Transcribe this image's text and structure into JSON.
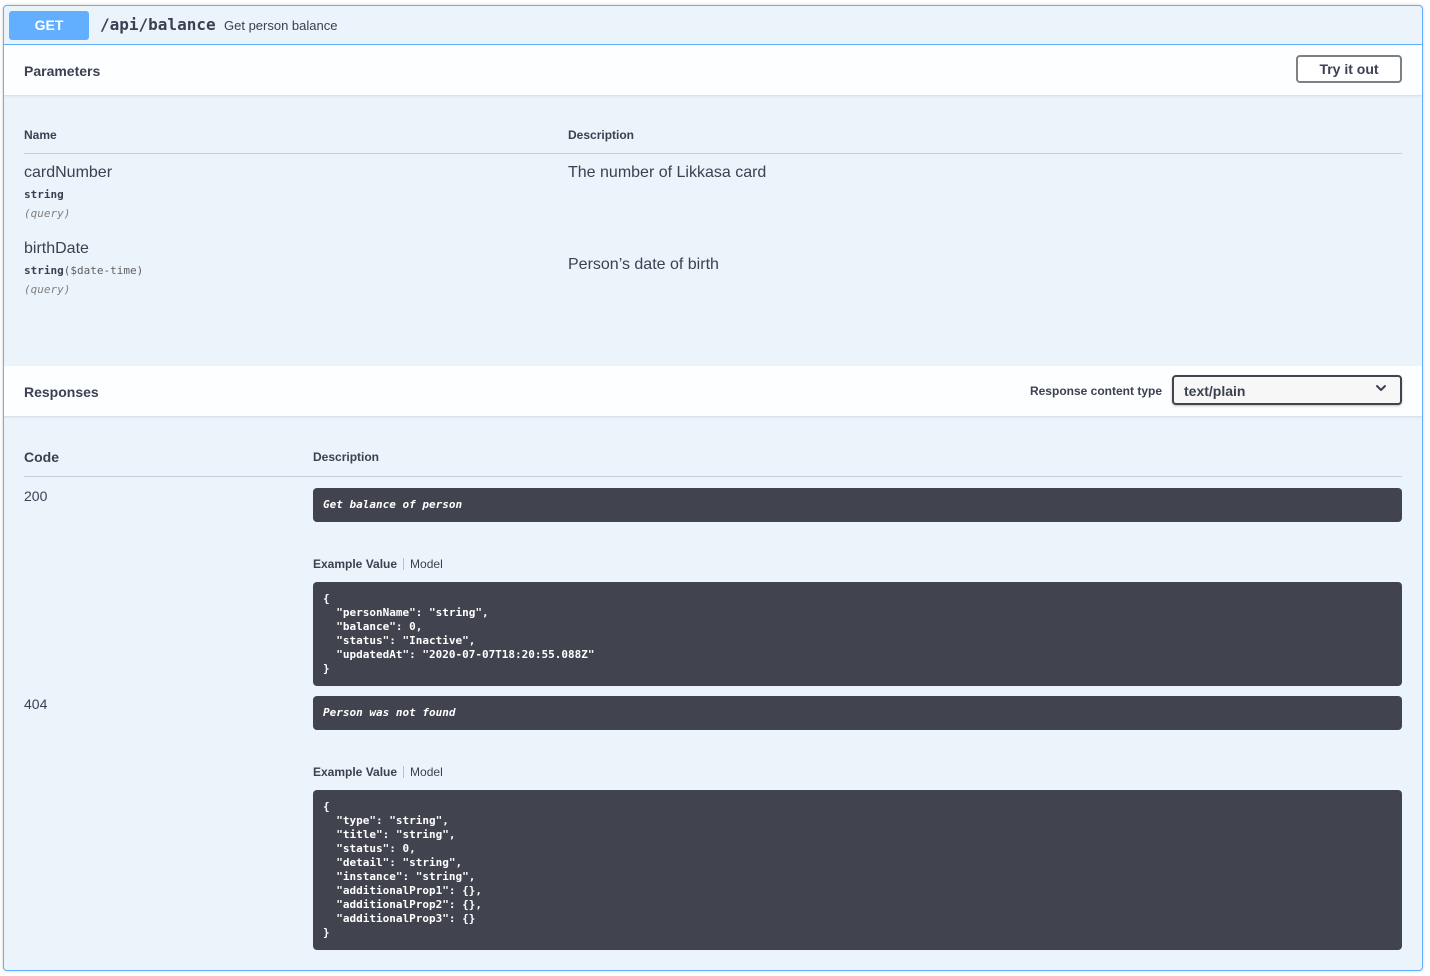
{
  "operation": {
    "method": "GET",
    "path": "/api/balance",
    "summary": "Get person balance"
  },
  "parameters": {
    "title": "Parameters",
    "try_it_out_label": "Try it out",
    "col_name": "Name",
    "col_description": "Description",
    "items": [
      {
        "name": "cardNumber",
        "type": "string",
        "format": "",
        "in": "(query)",
        "description": "The number of Likkasa card"
      },
      {
        "name": "birthDate",
        "type": "string",
        "format": "($date-time)",
        "in": "(query)",
        "description": "Person’s date of birth"
      }
    ]
  },
  "responses": {
    "title": "Responses",
    "content_type_label": "Response content type",
    "content_type_value": "text/plain",
    "col_code": "Code",
    "col_description": "Description",
    "example_tab": "Example Value",
    "model_tab": "Model",
    "items": [
      {
        "code": "200",
        "description": "Get balance of person",
        "example": "{\n  \"personName\": \"string\",\n  \"balance\": 0,\n  \"status\": \"Inactive\",\n  \"updatedAt\": \"2020-07-07T18:20:55.088Z\"\n}"
      },
      {
        "code": "404",
        "description": "Person was not found",
        "example": "{\n  \"type\": \"string\",\n  \"title\": \"string\",\n  \"status\": 0,\n  \"detail\": \"string\",\n  \"instance\": \"string\",\n  \"additionalProp1\": {},\n  \"additionalProp2\": {},\n  \"additionalProp3\": {}\n}"
      }
    ]
  },
  "colors": {
    "get_accent": "#61affe",
    "block_bg": "#ebf3fb",
    "code_bg": "#41444e"
  },
  "icons": {
    "select_arrow": "chevron-down-icon"
  }
}
